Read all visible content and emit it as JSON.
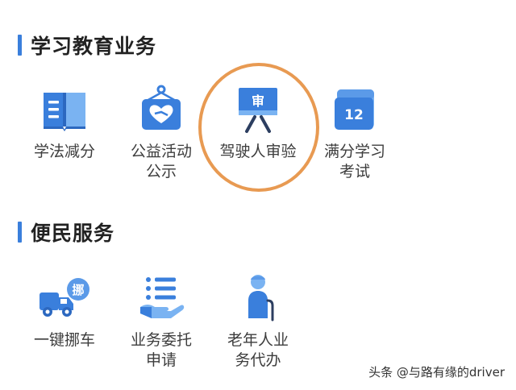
{
  "sections": [
    {
      "title": "学习教育业务",
      "items": [
        {
          "label": "学法减分",
          "icon": "open-book-icon"
        },
        {
          "label": "公益活动\n公示",
          "icon": "heart-hand-sign-icon"
        },
        {
          "label": "驾驶人审验",
          "icon": "review-board-icon",
          "icon_text": "审"
        },
        {
          "label": "满分学习\n考试",
          "icon": "calendar-12-icon",
          "icon_text": "12"
        }
      ]
    },
    {
      "title": "便民服务",
      "items": [
        {
          "label": "一键挪车",
          "icon": "tow-truck-icon",
          "icon_text": "挪"
        },
        {
          "label": "业务委托\n申请",
          "icon": "list-hand-icon"
        },
        {
          "label": "老年人业\n务代办",
          "icon": "elderly-person-icon"
        }
      ]
    }
  ],
  "watermark": "头条 @与路有缘的driver",
  "colors": {
    "primary_blue": "#3a7fdc",
    "light_blue": "#7ab3f2",
    "accent_orange": "#e89a52"
  }
}
